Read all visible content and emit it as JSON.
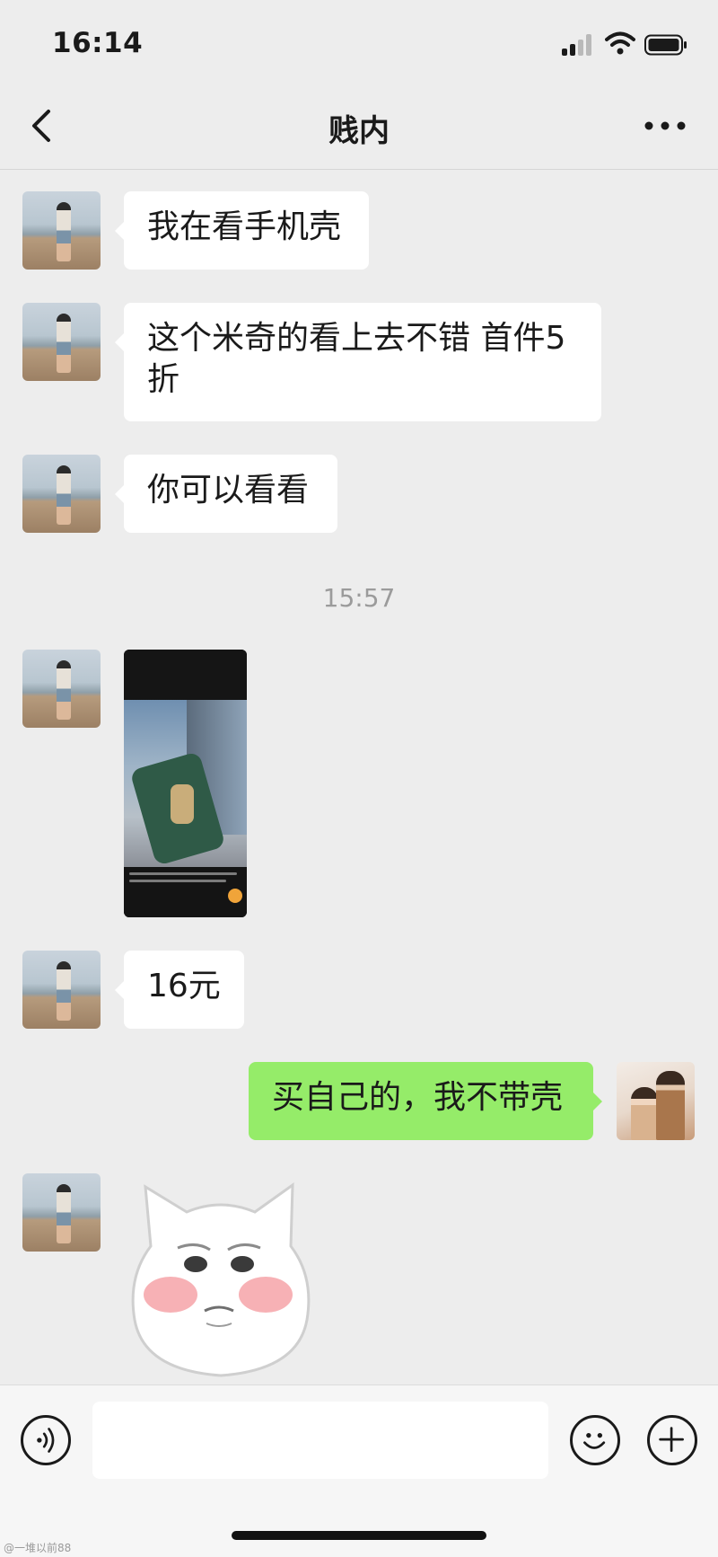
{
  "status_bar": {
    "time": "16:14"
  },
  "nav": {
    "title": "贱内"
  },
  "messages": [
    {
      "side": "left",
      "type": "text",
      "text": "我在看手机壳"
    },
    {
      "side": "left",
      "type": "text",
      "text": "这个米奇的看上去不错 首件5折"
    },
    {
      "side": "left",
      "type": "text",
      "text": "你可以看看"
    },
    {
      "type": "timestamp",
      "text": "15:57"
    },
    {
      "side": "left",
      "type": "image"
    },
    {
      "side": "left",
      "type": "text",
      "text": "16元"
    },
    {
      "side": "right",
      "type": "text",
      "text": "买自己的，我不带壳"
    },
    {
      "side": "left",
      "type": "sticker"
    }
  ],
  "input_bar": {
    "value": "",
    "placeholder": ""
  },
  "watermark": "@一堆以前88",
  "colors": {
    "background": "#ededed",
    "bubble_left": "#ffffff",
    "bubble_right": "#95ec69",
    "timestamp": "#9b9b9b"
  },
  "icons": [
    "back-icon",
    "more-icon",
    "voice-icon",
    "emoji-icon",
    "plus-icon",
    "signal-icon",
    "wifi-icon",
    "battery-icon"
  ]
}
